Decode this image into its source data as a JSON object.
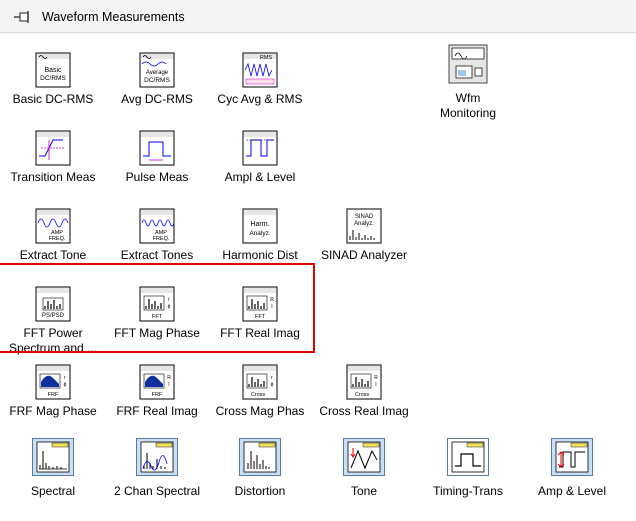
{
  "window": {
    "title": "Waveform Measurements"
  },
  "rows": [
    [
      {
        "name": "basic-dc-rms",
        "label": "Basic DC-RMS",
        "glyph": "Basic\nDC/RMS"
      },
      {
        "name": "avg-dc-rms",
        "label": "Avg DC-RMS",
        "glyph": "Average\nDC/RMS"
      },
      {
        "name": "cyc-avg-rms",
        "label": "Cyc Avg & RMS",
        "glyph": "RMS"
      },
      {
        "name": "wfm-monitoring",
        "label": "Wfm\nMonitoring",
        "glyph": ""
      }
    ],
    [
      {
        "name": "transition-meas",
        "label": "Transition Meas",
        "glyph": ""
      },
      {
        "name": "pulse-meas",
        "label": "Pulse Meas",
        "glyph": ""
      },
      {
        "name": "ampl-level",
        "label": "Ampl & Level",
        "glyph": ""
      }
    ],
    [
      {
        "name": "extract-tone",
        "label": "Extract Tone",
        "glyph": "AMP\nFREQ."
      },
      {
        "name": "extract-tones",
        "label": "Extract Tones",
        "glyph": "AMP\nFREQ."
      },
      {
        "name": "harmonic-dist",
        "label": "Harmonic Dist",
        "glyph": "Harm.\nAnalyz."
      },
      {
        "name": "sinad-analyzer",
        "label": "SINAD Analyzer",
        "glyph": "SINAD\nAnalyz."
      }
    ],
    [
      {
        "name": "fft-power-spectrum",
        "label": "FFT Power\nSpectrum and ...",
        "glyph": "PS/PSD"
      },
      {
        "name": "fft-mag-phase",
        "label": "FFT Mag Phase",
        "glyph": "FFT"
      },
      {
        "name": "fft-real-imag",
        "label": "FFT Real Imag",
        "glyph": "FFT"
      }
    ],
    [
      {
        "name": "frf-mag-phase",
        "label": "FRF Mag Phase",
        "glyph": "FRF"
      },
      {
        "name": "frf-real-imag",
        "label": "FRF Real Imag",
        "glyph": "FRF"
      },
      {
        "name": "cross-mag-phas",
        "label": "Cross Mag Phas",
        "glyph": "Cross"
      },
      {
        "name": "cross-real-imag",
        "label": "Cross Real Imag",
        "glyph": "Cross"
      }
    ],
    [
      {
        "name": "spectral",
        "label": "Spectral"
      },
      {
        "name": "two-chan-spectral",
        "label": "2 Chan Spectral"
      },
      {
        "name": "distortion",
        "label": "Distortion"
      },
      {
        "name": "tone",
        "label": "Tone"
      },
      {
        "name": "timing-trans",
        "label": "Timing-Trans"
      },
      {
        "name": "amp-level",
        "label": "Amp & Level"
      }
    ]
  ],
  "icons": {
    "pin": "pushpin-icon"
  },
  "colors": {
    "highlight": "#e00000",
    "express_bg": "#c9dff5",
    "wave_blue": "#0000ff"
  }
}
